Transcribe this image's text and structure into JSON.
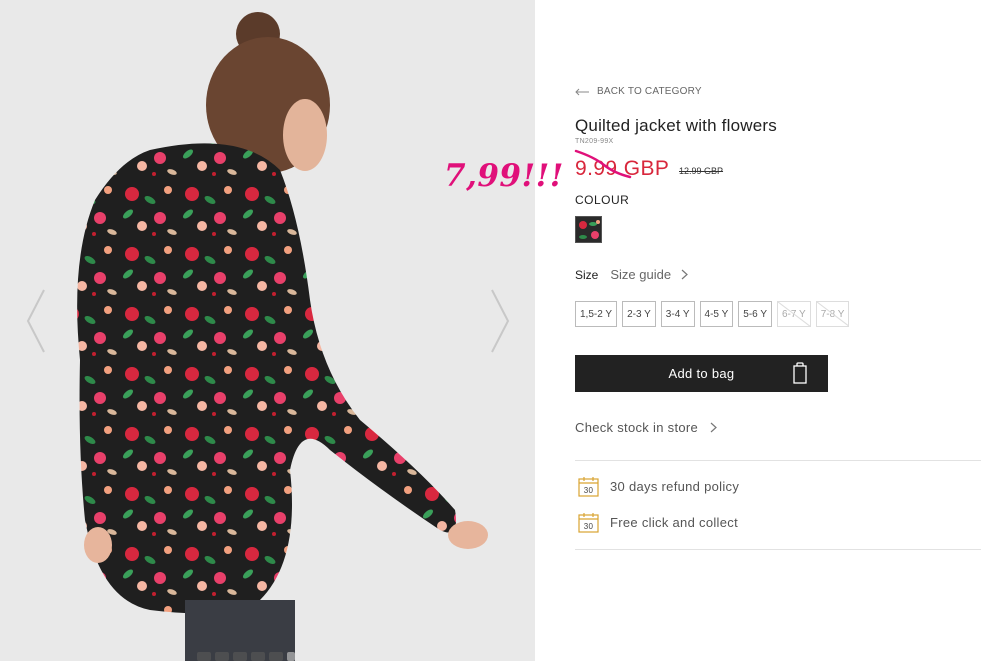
{
  "product": {
    "back_label": "BACK TO CATEGORY",
    "title": "Quilted jacket with flowers",
    "sku": "TN209-99X",
    "price_current": "9.99 GBP",
    "price_old": "12.99 GBP",
    "annotation": "7,99!!!",
    "colour_label": "COLOUR",
    "size_label": "Size",
    "size_guide_label": "Size guide",
    "sizes": [
      {
        "label": "1,5-2 Y",
        "available": true
      },
      {
        "label": "2-3 Y",
        "available": true
      },
      {
        "label": "3-4 Y",
        "available": true
      },
      {
        "label": "4-5 Y",
        "available": true
      },
      {
        "label": "5-6 Y",
        "available": true
      },
      {
        "label": "6-7 Y",
        "available": false
      },
      {
        "label": "7-8 Y",
        "available": false
      }
    ],
    "add_to_bag_label": "Add to bag",
    "check_stock_label": "Check stock in store",
    "perks": [
      {
        "icon": "calendar-30-icon",
        "badge": "30",
        "label": "30 days refund policy"
      },
      {
        "icon": "calendar-30-icon",
        "badge": "30",
        "label": "Free click and collect"
      }
    ]
  },
  "colors": {
    "price_red": "#d8273c",
    "annotation_pink": "#e0107a",
    "button_dark": "#222222",
    "perk_icon_gold": "#d9a431"
  }
}
